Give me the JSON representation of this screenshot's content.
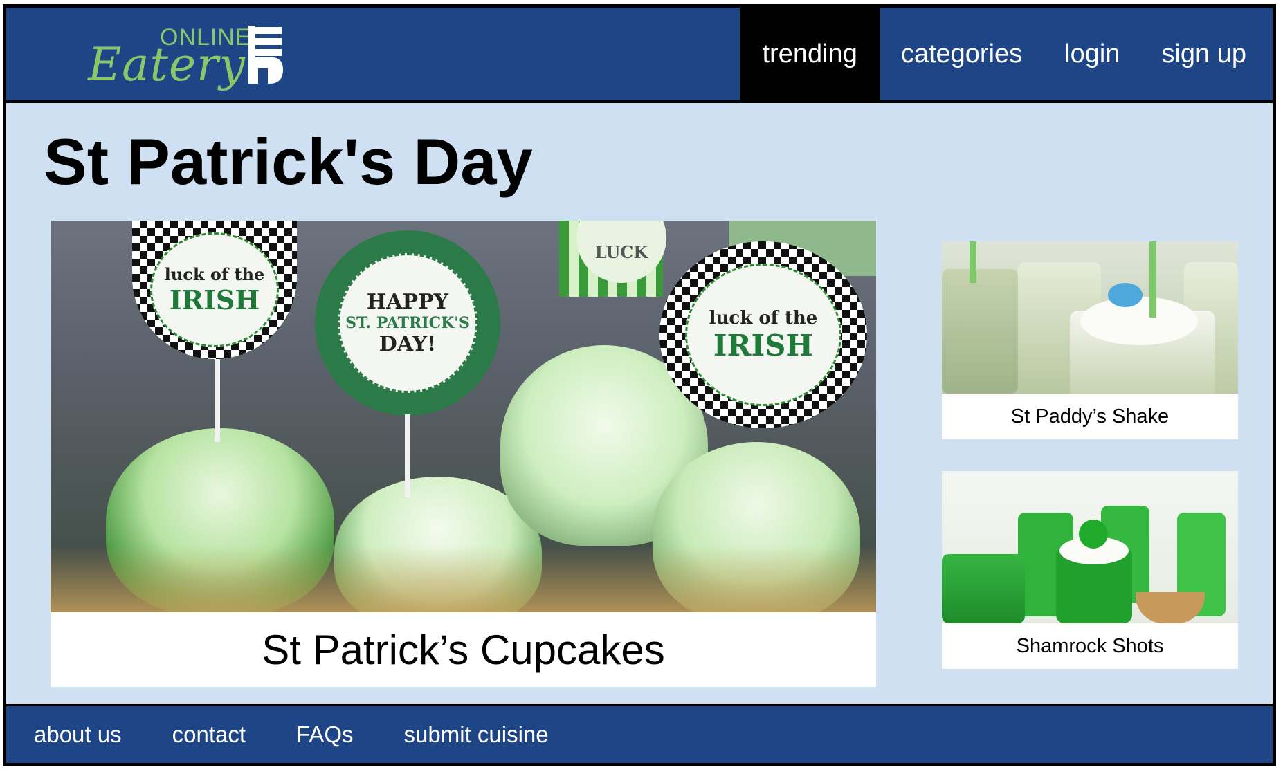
{
  "logo": {
    "line1": "ONLINE",
    "line2": "Eatery"
  },
  "nav": {
    "items": [
      {
        "label": "trending",
        "active": true
      },
      {
        "label": "categories",
        "active": false
      },
      {
        "label": "login",
        "active": false
      },
      {
        "label": "sign up",
        "active": false
      }
    ]
  },
  "page": {
    "title": "St Patrick's Day"
  },
  "feature": {
    "caption": "St Patrick’s Cupcakes",
    "toppers": [
      "luck of the",
      "IRISH",
      "HAPPY",
      "ST. PATRICK'S",
      "DAY!",
      "luck of the",
      "IRISH",
      "LUCK"
    ]
  },
  "side_cards": [
    {
      "caption": "St Paddy’s Shake"
    },
    {
      "caption": "Shamrock Shots"
    }
  ],
  "footer": {
    "links": [
      "about us",
      "contact",
      "FAQs",
      "submit cuisine"
    ]
  },
  "colors": {
    "header_bg": "#1e4585",
    "page_bg": "#cfe0f2",
    "logo_green": "#8cc66a",
    "active_nav": "#000000"
  }
}
